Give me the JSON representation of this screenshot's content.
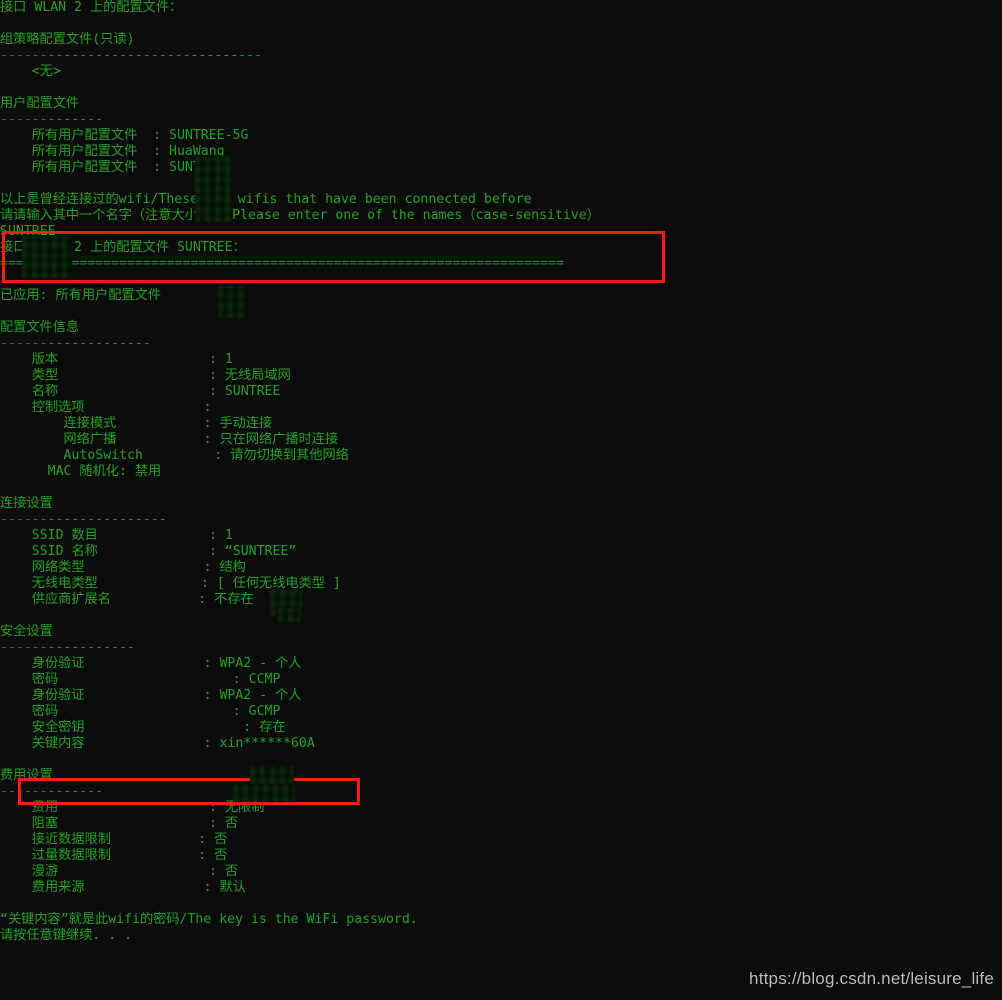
{
  "window": {
    "background_color": "#0c0c0c",
    "text_color": "#20a020",
    "annotation_color": "#ff1a12",
    "watermark_color": "#b9b9b9"
  },
  "console": {
    "lines": [
      "接口 WLAN 2 上的配置文件：",
      "",
      "组策略配置文件(只读)",
      "---------------------------------",
      "    <无>",
      "",
      "用户配置文件",
      "-------------",
      "    所有用户配置文件  : SUNTREE-5G",
      "    所有用户配置文件  : HuaWang",
      "    所有用户配置文件  : SUNTREE",
      "",
      "以上是曾经连接过的wifi/These are wifis that have been connected before",
      "请请输入其中一个名字（注意大小写）/Please enter one of the names（case-sensitive）",
      "SUNTREE",
      "接口 WLAN 2 上的配置文件 SUNTREE：",
      "=======================================================================",
      "",
      "已应用: 所有用户配置文件",
      "",
      "配置文件信息",
      "-------------------",
      "    版本                   : 1",
      "    类型                   : 无线局域网",
      "    名称                   : SUNTREE",
      "    控制选项               :",
      "        连接模式           : 手动连接",
      "        网络广播           : 只在网络广播时连接",
      "        AutoSwitch         : 请勿切换到其他网络",
      "      MAC 随机化: 禁用",
      "",
      "连接设置",
      "---------------------",
      "    SSID 数目              : 1",
      "    SSID 名称              : “SUNTREE”",
      "    网络类型               : 结构",
      "    无线电类型             : [ 任何无线电类型 ]",
      "    供应商扩展名           : 不存在",
      "",
      "安全设置",
      "-----------------",
      "    身份验证               : WPA2 - 个人",
      "    密码                      : CCMP",
      "    身份验证               : WPA2 - 个人",
      "    密码                      : GCMP",
      "    安全密钥                    : 存在",
      "    关键内容               : xin******60A",
      "",
      "费用设置",
      "-------------",
      "    费用                   : 无限制",
      "    阻塞                   : 否",
      "    接近数据限制           : 否",
      "    过量数据限制           : 否",
      "    漫游                   : 否",
      "    费用来源               : 默认",
      "",
      "“关键内容”就是此wifi的密码/The key is the WiFi password.",
      "请按任意键继续. . ."
    ]
  },
  "annotations": {
    "redbox_prompt_label": "red-highlight-around-name-prompt",
    "redbox_key_label": "red-highlight-around-key-content",
    "mosaic_label": "mosaic-censor-block"
  },
  "watermark": {
    "text": "https://blog.csdn.net/leisure_life"
  }
}
